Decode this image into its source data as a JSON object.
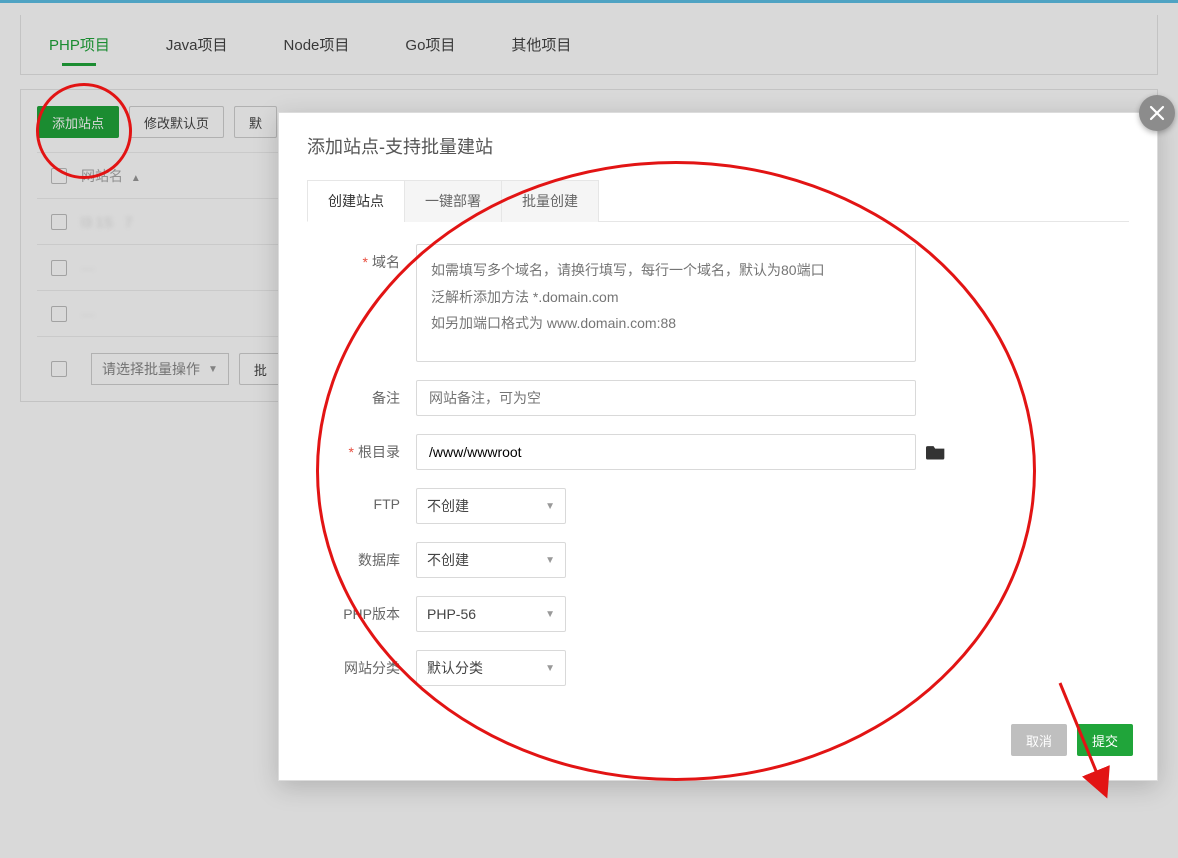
{
  "tabs": {
    "php": "PHP项目",
    "java": "Java项目",
    "node": "Node项目",
    "go": "Go项目",
    "other": "其他项目"
  },
  "toolbar": {
    "add_site": "添加站点",
    "edit_default": "修改默认页",
    "default": "默",
    "batch_exec": "批"
  },
  "table": {
    "col_sitename": "网站名",
    "rows": [
      "",
      "",
      ""
    ]
  },
  "batch": {
    "placeholder": "请选择批量操作"
  },
  "modal": {
    "title": "添加站点-支持批量建站",
    "tabs": {
      "create": "创建站点",
      "deploy": "一键部署",
      "batch": "批量创建"
    },
    "form": {
      "domain_label": "域名",
      "domain_placeholder": "如需填写多个域名，请换行填写，每行一个域名，默认为80端口\n泛解析添加方法 *.domain.com\n如另加端口格式为 www.domain.com:88",
      "remark_label": "备注",
      "remark_placeholder": "网站备注，可为空",
      "root_label": "根目录",
      "root_value": "/www/wwwroot",
      "ftp_label": "FTP",
      "ftp_value": "不创建",
      "db_label": "数据库",
      "db_value": "不创建",
      "php_label": "PHP版本",
      "php_value": "PHP-56",
      "cat_label": "网站分类",
      "cat_value": "默认分类"
    },
    "buttons": {
      "cancel": "取消",
      "submit": "提交"
    }
  }
}
